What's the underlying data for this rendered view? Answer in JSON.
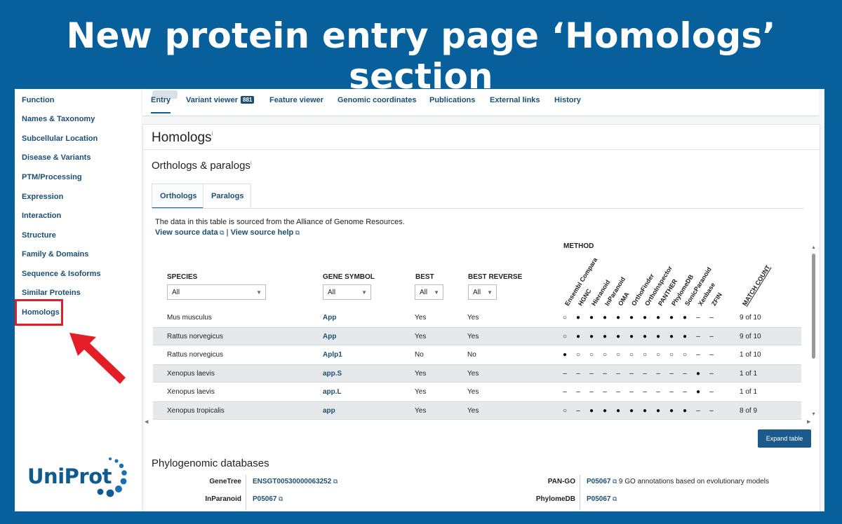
{
  "slide": {
    "title": "New protein entry page ‘Homologs’ section"
  },
  "sidebar": {
    "items": [
      {
        "label": "Function"
      },
      {
        "label": "Names & Taxonomy"
      },
      {
        "label": "Subcellular Location"
      },
      {
        "label": "Disease & Variants"
      },
      {
        "label": "PTM/Processing"
      },
      {
        "label": "Expression"
      },
      {
        "label": "Interaction"
      },
      {
        "label": "Structure"
      },
      {
        "label": "Family & Domains"
      },
      {
        "label": "Sequence & Isoforms"
      },
      {
        "label": "Similar Proteins"
      },
      {
        "label": "Homologs"
      }
    ],
    "highlight_color": "#e41e26",
    "logo_text": "UniProt"
  },
  "tabs": [
    {
      "label": "Entry",
      "active": true
    },
    {
      "label": "Variant viewer",
      "badge": "881"
    },
    {
      "label": "Feature viewer"
    },
    {
      "label": "Genomic coordinates"
    },
    {
      "label": "Publications"
    },
    {
      "label": "External links"
    },
    {
      "label": "History"
    }
  ],
  "homologs": {
    "title": "Homologs",
    "info_mark": "i",
    "orthologs_title": "Orthologs & paralogs",
    "subtabs": [
      {
        "label": "Orthologs",
        "active": true
      },
      {
        "label": "Paralogs"
      }
    ],
    "source_note": "The data in this table is sourced from the Alliance of Genome Resources.",
    "view_source_data": "View source data",
    "separator": "|",
    "view_source_help": "View source help",
    "table": {
      "method_label": "METHOD",
      "columns": {
        "species": "SPECIES",
        "gene_symbol": "GENE SYMBOL",
        "best": "BEST",
        "best_reverse": "BEST REVERSE",
        "match_count": "MATCH COUNT"
      },
      "filters": {
        "species": "All",
        "gene_symbol": "All",
        "best": "All",
        "best_reverse": "All"
      },
      "methods": [
        "Ensembl Compara",
        "HGNC",
        "Hieranoid",
        "InParanoid",
        "OMA",
        "OrthoFinder",
        "OrthoInspector",
        "PANTHER",
        "PhylomeDB",
        "SonicParanoid",
        "Xenbase",
        "ZFIN"
      ],
      "rows": [
        {
          "species": "Mus musculus",
          "symbol": "App",
          "best": "Yes",
          "best_reverse": "Yes",
          "marks": [
            "○",
            "●",
            "●",
            "●",
            "●",
            "●",
            "●",
            "●",
            "●",
            "●",
            "–",
            "–"
          ],
          "match": "9 of 10"
        },
        {
          "species": "Rattus norvegicus",
          "symbol": "App",
          "best": "Yes",
          "best_reverse": "Yes",
          "marks": [
            "○",
            "●",
            "●",
            "●",
            "●",
            "●",
            "●",
            "●",
            "●",
            "●",
            "–",
            "–"
          ],
          "match": "9 of 10"
        },
        {
          "species": "Rattus norvegicus",
          "symbol": "Aplp1",
          "best": "No",
          "best_reverse": "No",
          "marks": [
            "●",
            "○",
            "○",
            "○",
            "○",
            "○",
            "○",
            "○",
            "○",
            "○",
            "–",
            "–"
          ],
          "match": "1 of 10"
        },
        {
          "species": "Xenopus laevis",
          "symbol": "app.S",
          "best": "Yes",
          "best_reverse": "Yes",
          "marks": [
            "–",
            "–",
            "–",
            "–",
            "–",
            "–",
            "–",
            "–",
            "–",
            "–",
            "●",
            "–"
          ],
          "match": "1 of 1"
        },
        {
          "species": "Xenopus laevis",
          "symbol": "app.L",
          "best": "Yes",
          "best_reverse": "Yes",
          "marks": [
            "–",
            "–",
            "–",
            "–",
            "–",
            "–",
            "–",
            "–",
            "–",
            "–",
            "●",
            "–"
          ],
          "match": "1 of 1"
        },
        {
          "species": "Xenopus tropicalis",
          "symbol": "app",
          "best": "Yes",
          "best_reverse": "Yes",
          "marks": [
            "○",
            "–",
            "●",
            "●",
            "●",
            "●",
            "●",
            "●",
            "●",
            "●",
            "–",
            "–"
          ],
          "match": "8 of 9"
        }
      ]
    },
    "expand_button": "Expand table"
  },
  "phylogenomic": {
    "title": "Phylogenomic databases",
    "entries": [
      {
        "label": "GeneTree",
        "value": "ENSGT00530000063252"
      },
      {
        "label": "InParanoid",
        "value": "P05067"
      },
      {
        "label": "PAN-GO",
        "value": "P05067",
        "note": "9 GO annotations based on evolutionary models"
      },
      {
        "label": "PhylomeDB",
        "value": "P05067"
      }
    ]
  },
  "colors": {
    "background": "#07609b",
    "link": "#1b4f72",
    "highlight": "#e41e26",
    "button": "#1b5a8a"
  }
}
